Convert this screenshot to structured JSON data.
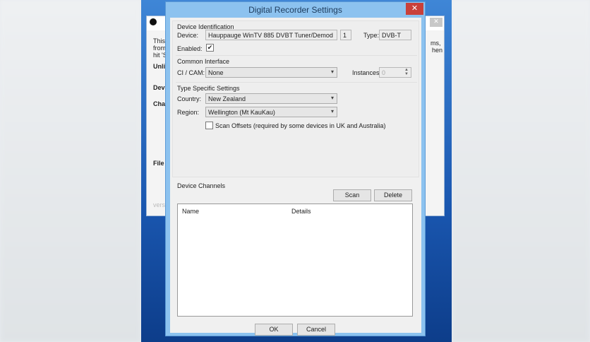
{
  "background_window": {
    "fragments": [
      "This",
      "from",
      "hit 'St",
      "Unli",
      "Devi",
      "Cha",
      "File",
      "versi",
      "ms,",
      "hen"
    ]
  },
  "dialog": {
    "title": "Digital Recorder Settings",
    "close_glyph": "✕",
    "device_identification": {
      "heading": "Device Identification",
      "device_label": "Device:",
      "device_value": "Hauppauge WinTV 885 DVBT Tuner/Demod",
      "index_value": "1",
      "type_label": "Type:",
      "type_value": "DVB-T",
      "enabled_label": "Enabled:",
      "enabled_checked": true,
      "check_glyph": "✔"
    },
    "common_interface": {
      "heading": "Common Interface",
      "cicam_label": "CI / CAM:",
      "cicam_value": "None",
      "instances_label": "Instances:",
      "instances_value": "0"
    },
    "type_specific": {
      "heading": "Type Specific Settings",
      "country_label": "Country:",
      "country_value": "New Zealand",
      "region_label": "Region:",
      "region_value": "Wellington (Mt KauKau)",
      "scan_offsets_label": "Scan Offsets (required by some devices in UK and Australia)",
      "scan_offsets_checked": false
    },
    "device_channels": {
      "heading": "Device Channels",
      "scan_label": "Scan",
      "delete_label": "Delete",
      "columns": [
        "Name",
        "Details"
      ]
    },
    "ok_label": "OK",
    "cancel_label": "Cancel"
  }
}
